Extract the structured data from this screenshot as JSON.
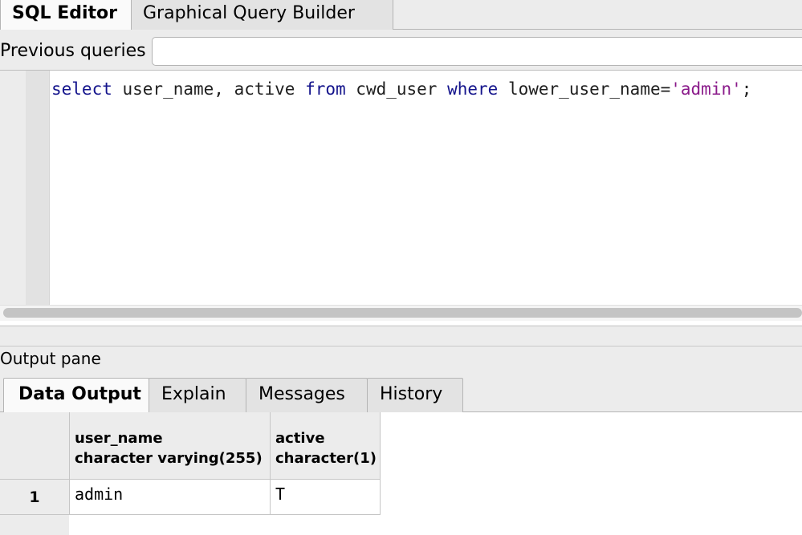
{
  "top_tabs": {
    "sql_editor": "SQL Editor",
    "query_builder": "Graphical Query Builder"
  },
  "previous_queries": {
    "label": "Previous queries",
    "value": ""
  },
  "editor": {
    "tokens": [
      {
        "text": "select",
        "kind": "kw"
      },
      {
        "text": " user_name, active ",
        "kind": "plain"
      },
      {
        "text": "from",
        "kind": "kw"
      },
      {
        "text": " cwd_user ",
        "kind": "plain"
      },
      {
        "text": "where",
        "kind": "kw"
      },
      {
        "text": " lower_user_name=",
        "kind": "plain"
      },
      {
        "text": "'admin'",
        "kind": "str"
      },
      {
        "text": ";",
        "kind": "plain"
      }
    ]
  },
  "output": {
    "title": "Output pane",
    "tabs": [
      "Data Output",
      "Explain",
      "Messages",
      "History"
    ]
  },
  "grid": {
    "columns": [
      {
        "name": "user_name",
        "type": "character varying(255)"
      },
      {
        "name": "active",
        "type": "character(1)"
      }
    ],
    "rows": [
      {
        "num": "1",
        "cells": [
          "admin",
          "T"
        ]
      }
    ]
  },
  "colors": {
    "keyword": "#14148c",
    "string": "#8a1a8a",
    "panel": "#ececec"
  }
}
